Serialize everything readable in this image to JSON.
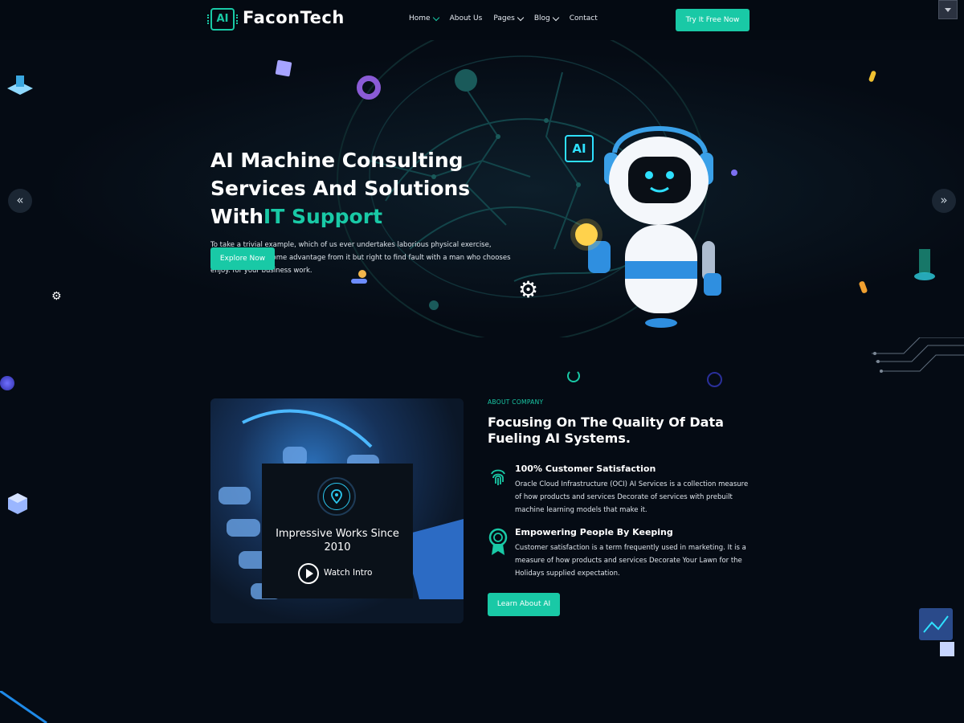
{
  "header": {
    "logo_icon_text": "AI",
    "logo_text": "FaconTech",
    "nav": [
      {
        "label": "Home",
        "has_dropdown": true,
        "active": true
      },
      {
        "label": "About Us",
        "has_dropdown": false,
        "active": false
      },
      {
        "label": "Pages",
        "has_dropdown": true,
        "active": false
      },
      {
        "label": "Blog",
        "has_dropdown": true,
        "active": false
      },
      {
        "label": "Contact",
        "has_dropdown": false,
        "active": false
      }
    ],
    "cta_label": "Try It Free Now"
  },
  "hero": {
    "title_line1": "AI Machine Consulting",
    "title_line2": "Services And Solutions",
    "title_line3_plain": "With",
    "title_line3_accent": "IT Support",
    "description": "To take a trivial example, which of us ever undertakes laborious physical exercise, except to obtain some advantage from it but right to find fault with a man who chooses enjoy. for your business work.",
    "button_label": "Explore Now",
    "prev_arrow": "«",
    "next_arrow": "»",
    "robot_chip_text": "AI"
  },
  "about": {
    "eyebrow": "ABOUT COMPANY",
    "title": "Focusing On The Quality Of Data Fueling AI Systems.",
    "video_card_title": "Impressive Works Since 2010",
    "watch_label": "Watch Intro",
    "features": [
      {
        "title": "100% Customer Satisfaction",
        "description": "Oracle Cloud Infrastructure (OCI) AI Services is a collection measure of how products and services Decorate of services with prebuilt machine learning models that make it.",
        "icon": "fingerprint-icon"
      },
      {
        "title": "Empowering People By Keeping",
        "description": "Customer satisfaction is a term frequently used in marketing. It is a measure of how products and services Decorate Your Lawn for the Holidays supplied expectation.",
        "icon": "award-badge-icon"
      }
    ],
    "button_label": "Learn About AI"
  },
  "colors": {
    "accent": "#19c9a6",
    "background": "#050b14"
  }
}
